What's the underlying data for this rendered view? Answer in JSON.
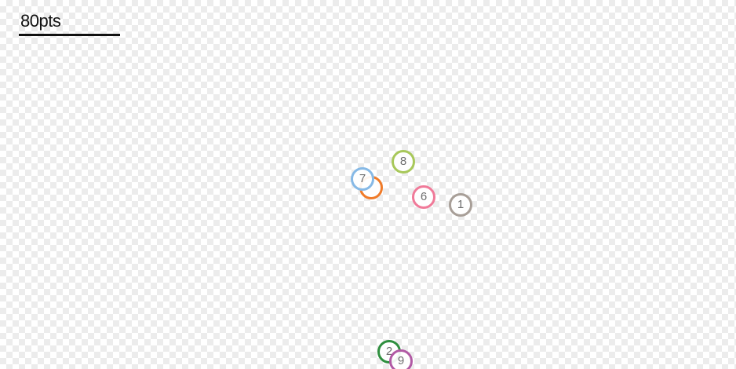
{
  "scale": {
    "label": "80pts"
  },
  "markers": [
    {
      "label": "1",
      "color": "#a89f98"
    },
    {
      "label": "2",
      "color": "#2f8f3f"
    },
    {
      "label": "6",
      "color": "#f07a99"
    },
    {
      "label": "7",
      "color": "#86b9e6"
    },
    {
      "label": "8",
      "color": "#a8c85a"
    },
    {
      "label": "9",
      "color": "#b15aa4"
    },
    {
      "label": "",
      "color": "#f07b29"
    }
  ]
}
